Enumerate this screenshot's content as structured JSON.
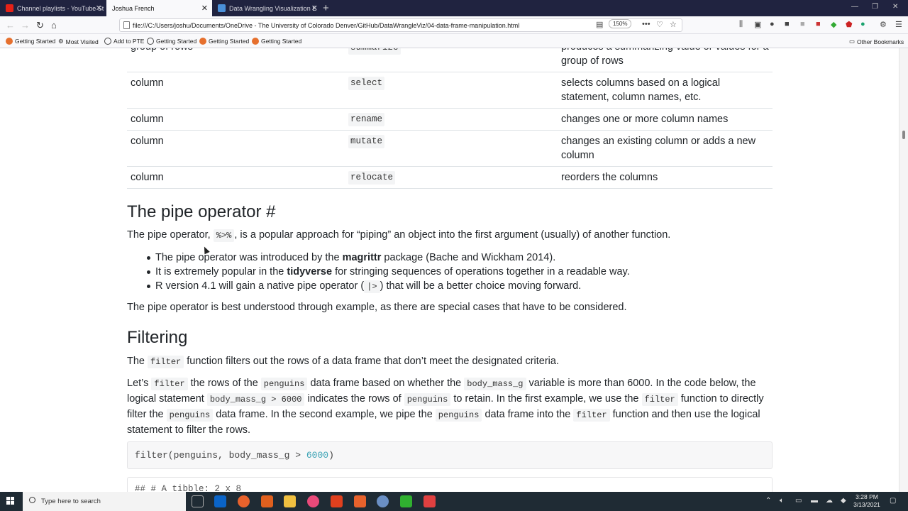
{
  "tabs": [
    {
      "label": "Channel playlists - YouTube St",
      "color": "#e62117"
    },
    {
      "label": "Joshua French",
      "color": "#f9f9fb"
    },
    {
      "label": "Data Wrangling Visualization E",
      "color": "#4a90d9"
    }
  ],
  "nav": {
    "url": "file:///C:/Users/joshu/Documents/OneDrive - The University of Colorado Denver/GitHub/DataWrangleViz/04-data-frame-manipulation.html",
    "zoom": "150%"
  },
  "bookmarks": [
    "Getting Started",
    "Most Visited",
    "Add to PTE",
    "Getting Started",
    "Getting Started",
    "Getting Started"
  ],
  "other_bookmarks": "Other Bookmarks",
  "table": {
    "rows": [
      {
        "c1": "group of rows",
        "c2": "summarize",
        "c3": "produces a summarizing value or values for a group of rows"
      },
      {
        "c1": "column",
        "c2": "select",
        "c3": "selects columns based on a logical statement, column names, etc."
      },
      {
        "c1": "column",
        "c2": "rename",
        "c3": "changes one or more column names"
      },
      {
        "c1": "column",
        "c2": "mutate",
        "c3": "changes an existing column or adds a new column"
      },
      {
        "c1": "column",
        "c2": "relocate",
        "c3": "reorders the columns"
      }
    ]
  },
  "pipe": {
    "heading": "The pipe operator",
    "anchor": "#",
    "p1_a": "The pipe operator,",
    "p1_code": "%>%",
    "p1_b": ", is a popular approach for “piping” an object into the first argument (usually) of another function.",
    "b1_a": "The pipe operator was introduced by the",
    "b1_bold": "magrittr",
    "b1_b": "package (Bache and Wickham 2014).",
    "b2_a": "It is extremely popular in the",
    "b2_bold": "tidyverse",
    "b2_b": "for stringing sequences of operations together in a readable way.",
    "b3_a": "R version 4.1 will gain a native pipe operator (",
    "b3_code": "|>",
    "b3_b": ") that will be a better choice moving forward.",
    "p2": "The pipe operator is best understood through example, as there are special cases that have to be considered."
  },
  "filtering": {
    "heading": "Filtering",
    "p1_a": "The",
    "p1_code": "filter",
    "p1_b": "function filters out the rows of a data frame that don’t meet the designated criteria.",
    "p2_lets": "Let’s",
    "p2_filter": "filter",
    "p2_a": "the rows of the",
    "p2_penguins": "penguins",
    "p2_b": "data frame based on whether the",
    "p2_body": "body_mass_g",
    "p2_c": "variable is more than 6000. In the code below, the",
    "p2_d": "logical statement",
    "p2_expr": "body_mass_g > 6000",
    "p2_e": "indicates the rows of",
    "p2_penguins2": "penguins",
    "p2_f": "to retain. In the first example, we use the",
    "p2_filter2": "filter",
    "p2_g": "function to directly",
    "p2_h": "filter the",
    "p2_penguins3": "penguins",
    "p2_i": "data frame. In the second example, we pipe the",
    "p2_penguins4": "penguins",
    "p2_j": "data frame into the",
    "p2_filter3": "filter",
    "p2_k": "function and then use the logical",
    "p2_l": "statement to filter the rows.",
    "code_a": "filter(penguins, body_mass_g > ",
    "code_num": "6000",
    "code_b": ")",
    "output": "## # A tibble: 2 x 8"
  },
  "taskbar": {
    "search_placeholder": "Type here to search",
    "time": "3:28 PM",
    "date": "3/13/2021"
  }
}
